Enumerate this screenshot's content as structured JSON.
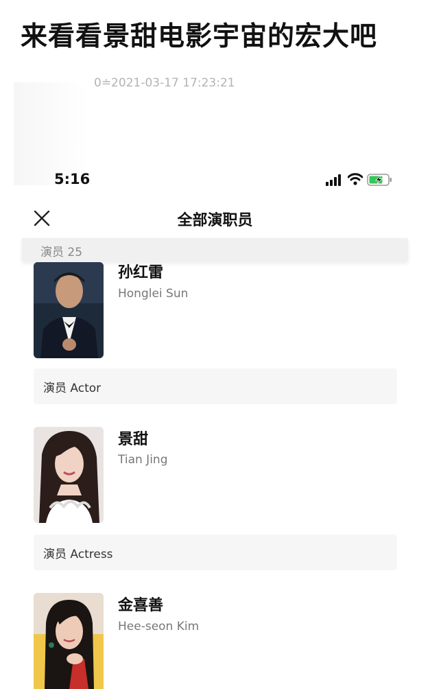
{
  "post": {
    "title": "来看看景甜电影宇宙的宏大吧",
    "timestamp": "0≐2021-03-17 17:23:21"
  },
  "status_bar": {
    "time": "5:16",
    "icons": [
      "signal-icon",
      "wifi-icon",
      "battery-charging-icon"
    ],
    "battery_color": "#35c759"
  },
  "nav": {
    "close_icon": "close-icon",
    "title": "全部演职员"
  },
  "section": {
    "label": "演员 25"
  },
  "cast": [
    {
      "name": "孙红雷",
      "latin_name": "Honglei Sun",
      "role": "演员 Actor",
      "avatar_icon": "portrait-photo"
    },
    {
      "name": "景甜",
      "latin_name": "Tian Jing",
      "role": "演员 Actress",
      "avatar_icon": "portrait-photo"
    },
    {
      "name": "金喜善",
      "latin_name": "Hee-seon Kim",
      "avatar_icon": "portrait-photo"
    }
  ]
}
